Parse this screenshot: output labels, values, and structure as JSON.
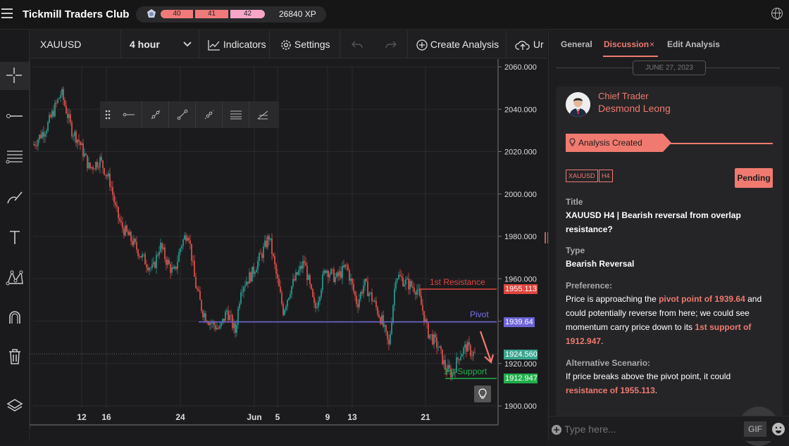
{
  "app": {
    "title": "Tickmill Traders Club"
  },
  "xp": {
    "level1": "40",
    "level2": "41",
    "level3": "42",
    "points": "26840 XP"
  },
  "toolbar": {
    "symbol": "XAUUSD",
    "timeframe": "4 hour",
    "indicators": "Indicators",
    "settings": "Settings",
    "create": "Create Analysis",
    "upload": "Ur"
  },
  "chart": {
    "price_labels": [
      "2060.000",
      "2040.000",
      "2020.000",
      "2000.000",
      "1980.000",
      "1960.000",
      "1940",
      "1920.000",
      "1900.000"
    ],
    "date_labels": [
      "12",
      "16",
      "24",
      "Jun",
      "5",
      "9",
      "13",
      "21"
    ],
    "levels": {
      "resistance": {
        "label": "1st Resistance",
        "value": "1955.113",
        "color": "#e0463e"
      },
      "pivot": {
        "label": "Pivot",
        "value": "1939.64",
        "color": "#6c63d8"
      },
      "current": {
        "value": "1924.560",
        "color": "#3aa58e"
      },
      "support": {
        "label": "1st Support",
        "value": "1912.947",
        "color": "#22b04c"
      }
    }
  },
  "panel": {
    "tabs": [
      "General",
      "Discussion",
      "Edit Analysis"
    ],
    "close_tab": "×",
    "date": "JUNE 27, 2023",
    "card": {
      "role": "Chief Trader",
      "name": "Desmond Leong",
      "banner": "Analysis Created",
      "tags": [
        "XAUUSD",
        "H4"
      ],
      "status": "Pending",
      "title_label": "Title",
      "title_value": "XAUUSD H4 | Bearish reversal from overlap resistance?",
      "type_label": "Type",
      "type_value": "Bearish Reversal",
      "pref_label": "Preference:",
      "pref_parts": [
        "Price is approaching the ",
        "pivot point of 1939.64",
        " and could potentially reverse from here; we could see momentum carry price down to its ",
        "1st support of 1912.947",
        "."
      ],
      "alt_label": "Alternative Scenario:",
      "alt_parts": [
        "If price breaks above the pivot point, it could",
        "resistance of 1955.113",
        "."
      ]
    },
    "composer": {
      "placeholder": "Type here...",
      "gif": "GIF"
    }
  },
  "colors": {
    "accent": "#f07a70",
    "bull": "#26a69a",
    "bear": "#ef5350"
  }
}
